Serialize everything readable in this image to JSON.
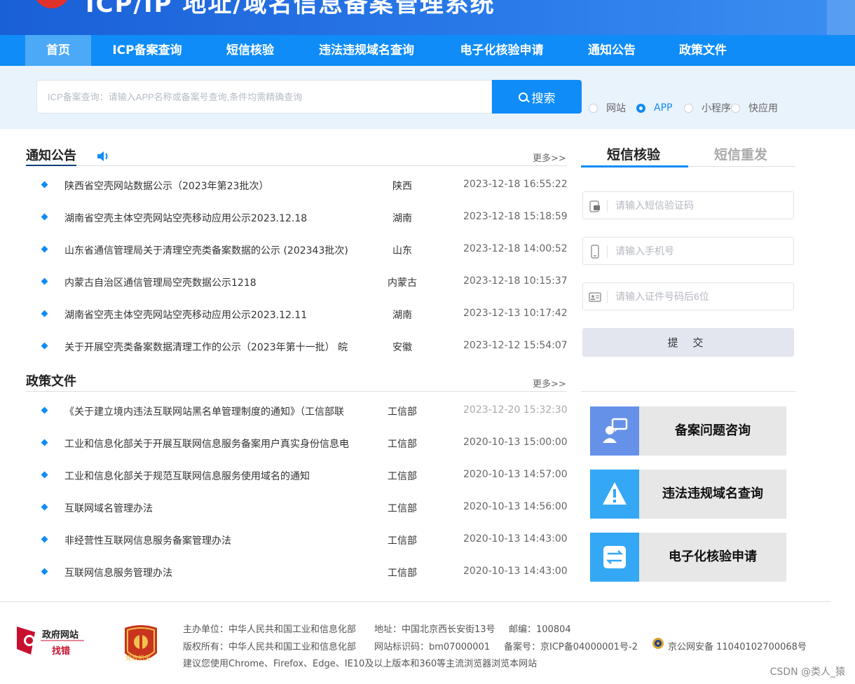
{
  "header": {
    "title": "ICP/IP 地址/域名信息备案管理系统"
  },
  "nav": {
    "items": [
      "首页",
      "ICP备案查询",
      "短信核验",
      "违法违规域名查询",
      "电子化核验申请",
      "通知公告",
      "政策文件"
    ],
    "active_index": 0
  },
  "search": {
    "placeholder": "ICP备案查询：请输入APP名称或备案号查询,条件均需精确查询",
    "button_label": "搜索",
    "options": [
      {
        "label": "网站",
        "checked": false
      },
      {
        "label": "APP",
        "checked": true
      },
      {
        "label": "小程序",
        "checked": false
      },
      {
        "label": "快应用",
        "checked": false
      }
    ]
  },
  "notices": {
    "title": "通知公告",
    "more": "更多>>",
    "rows": [
      {
        "title": "陕西省空壳网站数据公示（2023年第23批次）",
        "region": "陕西",
        "date": "2023-12-18 16:55:22"
      },
      {
        "title": "湖南省空壳主体空壳网站空壳移动应用公示2023.12.18",
        "region": "湖南",
        "date": "2023-12-18 15:18:59"
      },
      {
        "title": "山东省通信管理局关于清理空壳类备案数据的公示 (202343批次)",
        "region": "山东",
        "date": "2023-12-18 14:00:52"
      },
      {
        "title": "内蒙古自治区通信管理局空壳数据公示1218",
        "region": "内蒙古",
        "date": "2023-12-18 10:15:37"
      },
      {
        "title": "湖南省空壳主体空壳网站空壳移动应用公示2023.12.11",
        "region": "湖南",
        "date": "2023-12-13 10:17:42"
      },
      {
        "title": "关于开展空壳类备案数据清理工作的公示（2023年第十一批） 皖",
        "region": "安徽",
        "date": "2023-12-12 15:54:07"
      }
    ]
  },
  "policies": {
    "title": "政策文件",
    "more": "更多>>",
    "rows": [
      {
        "title": "《关于建立境内违法互联网站黑名单管理制度的通知》（工信部联",
        "region": "工信部",
        "date": "2023-12-20 15:32:30"
      },
      {
        "title": "工业和信息化部关于开展互联网信息服务备案用户真实身份信息电",
        "region": "工信部",
        "date": "2020-10-13 15:00:00"
      },
      {
        "title": "工业和信息化部关于规范互联网信息服务使用域名的通知",
        "region": "工信部",
        "date": "2020-10-13 14:57:00"
      },
      {
        "title": "互联网域名管理办法",
        "region": "工信部",
        "date": "2020-10-13 14:56:00"
      },
      {
        "title": "非经营性互联网信息服务备案管理办法",
        "region": "工信部",
        "date": "2020-10-13 14:43:00"
      },
      {
        "title": "互联网信息服务管理办法",
        "region": "工信部",
        "date": "2020-10-13 14:43:00"
      }
    ]
  },
  "sms": {
    "tabs": [
      "短信核验",
      "短信重发"
    ],
    "active_tab": 0,
    "code_placeholder": "请输入短信验证码",
    "phone_placeholder": "请输入手机号",
    "id_placeholder": "请输入证件号码后6位",
    "submit_label": "提 交"
  },
  "cards": [
    {
      "label": "备案问题咨询",
      "icon": "consult-icon",
      "color": "#6591e8"
    },
    {
      "label": "违法违规域名查询",
      "icon": "warning-icon",
      "color": "#34a7f5"
    },
    {
      "label": "电子化核验申请",
      "icon": "exchange-icon",
      "color": "#34a7f5"
    }
  ],
  "footer": {
    "gov_logo_line1": "政府网站",
    "gov_logo_line2": "找错",
    "badge_text": "党政机关",
    "host": "主办单位：中华人民共和国工业和信息化部",
    "address": "地址：中国北京西长安街13号",
    "postcode": "邮编：100804",
    "copyright": "版权所有：中华人民共和国工业和信息化部",
    "site_code": "网站标识码：bm07000001",
    "icp": "备案号：京ICP备04000001号-2",
    "police": "京公网安备 11040102700068号",
    "browser_note": "建议您使用Chrome、Firefox、Edge、IE10及以上版本和360等主流浏览器浏览本网站"
  },
  "watermark": "CSDN @类人_猿"
}
